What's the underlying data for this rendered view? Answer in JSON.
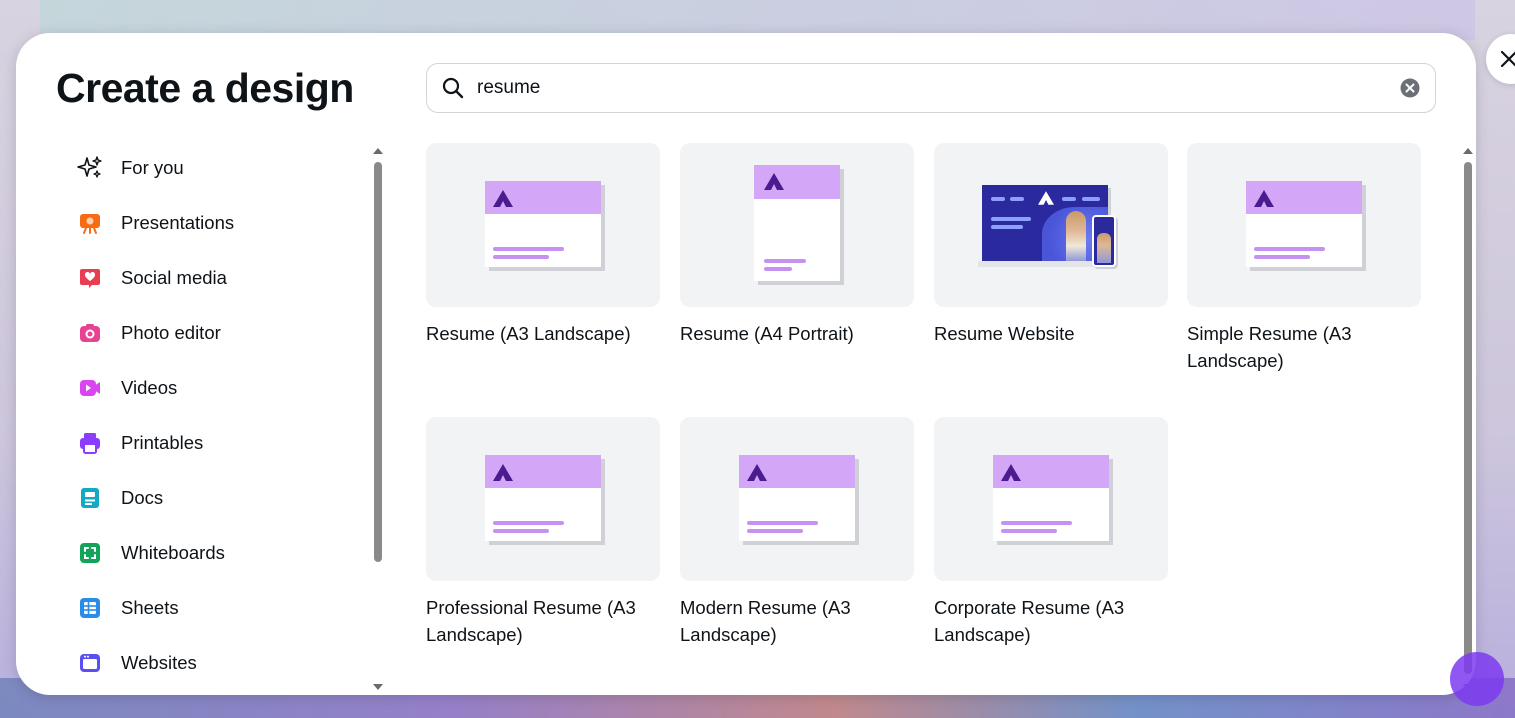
{
  "dialog": {
    "title": "Create a design",
    "close_icon": "close-icon"
  },
  "search": {
    "value": "resume",
    "icon": "search-icon",
    "clear_icon": "clear-icon"
  },
  "sidebar": {
    "items": [
      {
        "label": "For you",
        "icon": "sparkle-icon",
        "color": "#0e1318"
      },
      {
        "label": "Presentations",
        "icon": "presentation-icon",
        "color": "#f76b15"
      },
      {
        "label": "Social media",
        "icon": "heart-icon",
        "color": "#e93d52"
      },
      {
        "label": "Photo editor",
        "icon": "camera-icon",
        "color": "#e84393"
      },
      {
        "label": "Videos",
        "icon": "video-icon",
        "color": "#d946ef"
      },
      {
        "label": "Printables",
        "icon": "printer-icon",
        "color": "#8b3dff"
      },
      {
        "label": "Docs",
        "icon": "doc-icon",
        "color": "#13a8c4"
      },
      {
        "label": "Whiteboards",
        "icon": "whiteboard-icon",
        "color": "#13a35b"
      },
      {
        "label": "Sheets",
        "icon": "sheets-icon",
        "color": "#2b8be8"
      },
      {
        "label": "Websites",
        "icon": "website-icon",
        "color": "#5a4ff0"
      }
    ]
  },
  "results": [
    {
      "label": "Resume (A3 Landscape)",
      "thumb": "landscape"
    },
    {
      "label": "Resume (A4 Portrait)",
      "thumb": "portrait"
    },
    {
      "label": "Resume Website",
      "thumb": "website"
    },
    {
      "label": "Simple Resume (A3 Landscape)",
      "thumb": "landscape"
    },
    {
      "label": "Professional Resume (A3 Landscape)",
      "thumb": "landscape"
    },
    {
      "label": "Modern Resume (A3 Landscape)",
      "thumb": "landscape"
    },
    {
      "label": "Corporate Resume (A3 Landscape)",
      "thumb": "landscape"
    }
  ],
  "colors": {
    "accent_light": "#d3a6f7",
    "accent_line": "#c692f1",
    "logo": "#4b1c8f",
    "website_bg": "#2a2a9e"
  }
}
